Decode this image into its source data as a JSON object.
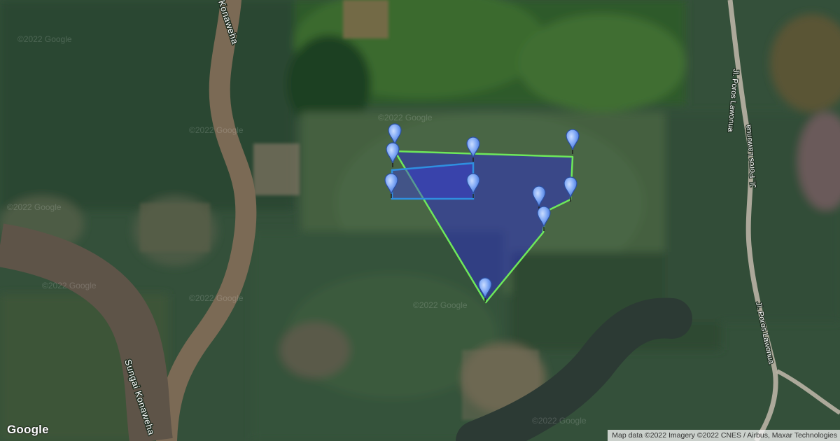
{
  "map": {
    "map_type": "satellite",
    "labels": {
      "river_top": "Konaweha",
      "river_bottom": "Sungai Konaweha",
      "road_upper": "Jl. Poros Lawonua",
      "road_lower": "Jl. Poros Lawonua"
    },
    "watermark": "©2022 Google",
    "logo": "Google",
    "attribution": "Map data ©2022 Imagery ©2022 CNES / Airbus, Maxar Technologies"
  },
  "overlay": {
    "main_polygon_outline_color": "#6ee85a",
    "main_polygon_fill_color": "#2e2fc0",
    "inner_rectangle_outline_color": "#2f8fe0",
    "inner_rectangle_fill_color": "#3a3fd8",
    "marker_color": "#7fa8f5",
    "marker_count": 10
  }
}
